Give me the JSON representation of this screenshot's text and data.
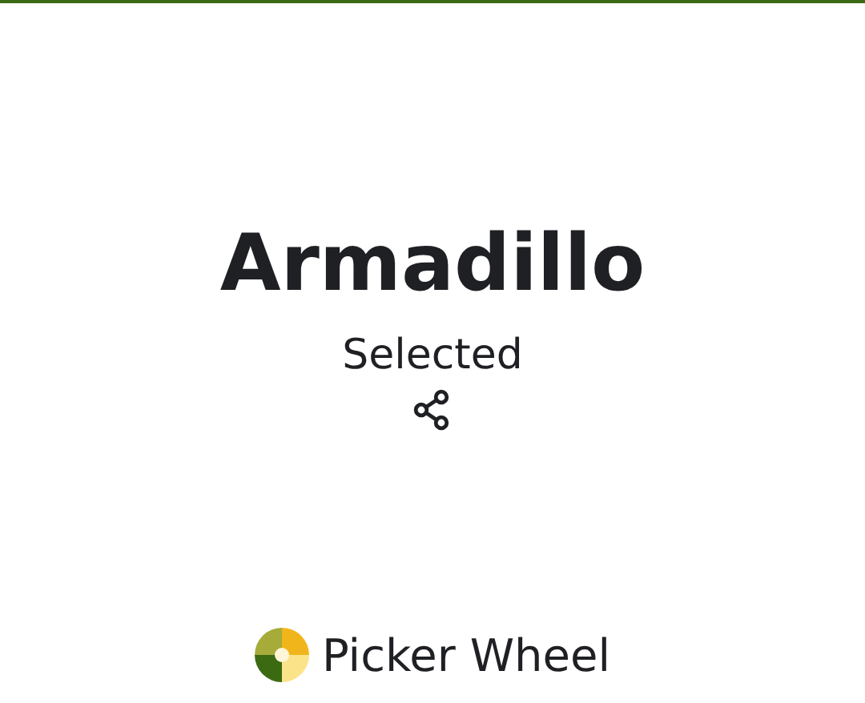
{
  "result": {
    "title": "Armadillo",
    "status": "Selected"
  },
  "footer": {
    "brand": "Picker Wheel"
  }
}
